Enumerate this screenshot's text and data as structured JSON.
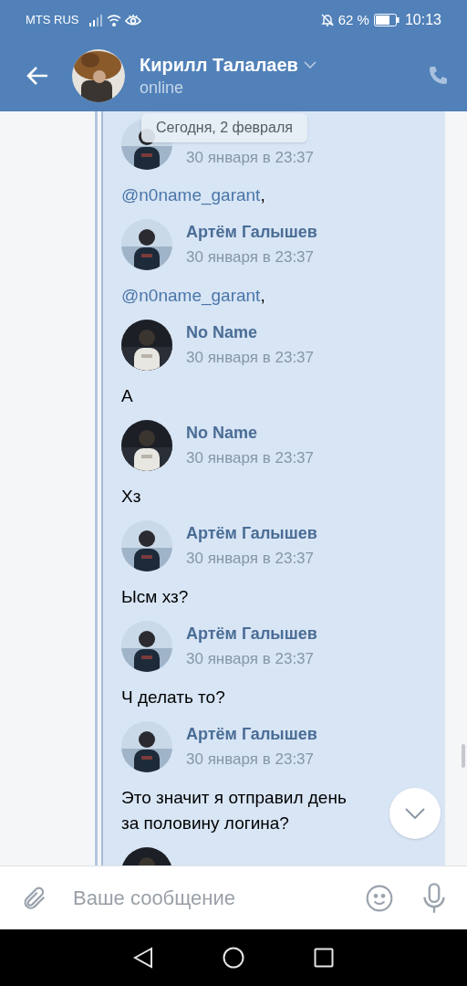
{
  "status_bar": {
    "carrier": "MTS RUS",
    "battery": "62 %",
    "time": "10:13"
  },
  "header": {
    "name": "Кирилл Талалаев",
    "status": "online"
  },
  "date_badge": "Сегодня, 2 февраля",
  "messages": [
    {
      "date": "30 января в 23:37",
      "mention": "@n0name_garant",
      "text": ","
    },
    {
      "author": "Артём Галышев",
      "date": "30 января в 23:37",
      "mention": "@n0name_garant",
      "text": ","
    },
    {
      "author": "No Name",
      "date": "30 января в 23:37",
      "text": "А"
    },
    {
      "author": "No Name",
      "date": "30 января в 23:37",
      "text": "Хз"
    },
    {
      "author": "Артём Галышев",
      "date": "30 января в 23:37",
      "text": "Ысм хз?"
    },
    {
      "author": "Артём Галышев",
      "date": "30 января в 23:37",
      "text": "Ч делать то?"
    },
    {
      "author": "Артём Галышев",
      "date": "30 января в 23:37",
      "text": "Это значит я отправил день\nза половину логина?"
    }
  ],
  "composer": {
    "placeholder": "Ваше сообщение"
  }
}
